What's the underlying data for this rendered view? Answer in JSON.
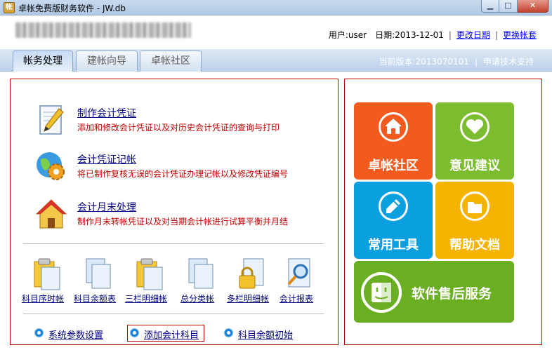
{
  "window": {
    "title": "卓帐免费版财务软件 - JW.db",
    "controls": {
      "minimize": "▁",
      "maximize": "□",
      "close": "✕"
    }
  },
  "header": {
    "user_label": "用户:user",
    "date_label": "日期:2013-12-01",
    "change_date": "更改日期",
    "separator": "|",
    "switch_account": "更换帐套"
  },
  "tabs": [
    {
      "label": "帐务处理"
    },
    {
      "label": "建帐向导"
    },
    {
      "label": "卓帐社区"
    }
  ],
  "version": {
    "text": "当前版本:2013070101",
    "separator": "|",
    "support": "申请技术支持"
  },
  "tasks": [
    {
      "title": "制作会计凭证",
      "desc": "添加和修改会计凭证以及对历史会计凭证的查询与打印",
      "icon": "edit-voucher-icon"
    },
    {
      "title": "会计凭证记帐",
      "desc": "将已制作复核无误的会计凭证办理记帐以及修改凭证编号",
      "icon": "globe-gear-icon"
    },
    {
      "title": "会计月末处理",
      "desc": "制作月末转帐凭证以及对当期会计帐进行试算平衡并月结",
      "icon": "house-icon"
    }
  ],
  "reports": [
    {
      "label": "科目序时帐",
      "icon": "clipboard-document-icon"
    },
    {
      "label": "科目余额表",
      "icon": "document-icon"
    },
    {
      "label": "三栏明细帐",
      "icon": "clipboard-document-icon"
    },
    {
      "label": "总分类帐",
      "icon": "document-icon"
    },
    {
      "label": "多栏明细帐",
      "icon": "locked-document-icon"
    },
    {
      "label": "会计报表",
      "icon": "search-document-icon"
    }
  ],
  "links": [
    {
      "label": "系统参数设置"
    },
    {
      "label": "添加会计科目"
    },
    {
      "label": "科目余额初始"
    }
  ],
  "tiles": [
    {
      "label": "卓帐社区",
      "color": "#f25a1e",
      "icon": "house-icon"
    },
    {
      "label": "意见建议",
      "color": "#7cbc2f",
      "icon": "heart-icon"
    },
    {
      "label": "常用工具",
      "color": "#0aa0e0",
      "icon": "pencil-icon"
    },
    {
      "label": "帮助文档",
      "color": "#f6b300",
      "icon": "folder-icon"
    },
    {
      "label": "软件售后服务",
      "color": "#6aae22",
      "icon": "finder-face-icon"
    }
  ]
}
